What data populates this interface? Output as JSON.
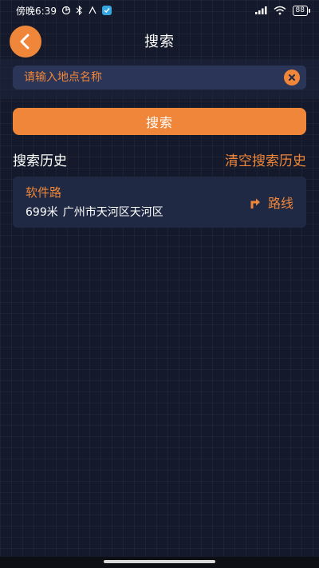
{
  "status_bar": {
    "time": "傍晚6:39",
    "battery": "88"
  },
  "header": {
    "title": "搜索"
  },
  "search": {
    "placeholder": "请输入地点名称",
    "value": "",
    "button_label": "搜索"
  },
  "history": {
    "title": "搜索历史",
    "clear_label": "清空搜索历史",
    "items": [
      {
        "name": "软件路",
        "distance": "699米",
        "address": "广州市天河区天河区",
        "route_label": "路线"
      }
    ]
  },
  "colors": {
    "accent": "#f0863a",
    "background": "#141a2b",
    "card": "#1f2944",
    "input": "#2a3558"
  },
  "icons": {
    "back": "chevron-left-icon",
    "clear": "close-circle-icon",
    "route": "turn-right-arrow-icon"
  }
}
